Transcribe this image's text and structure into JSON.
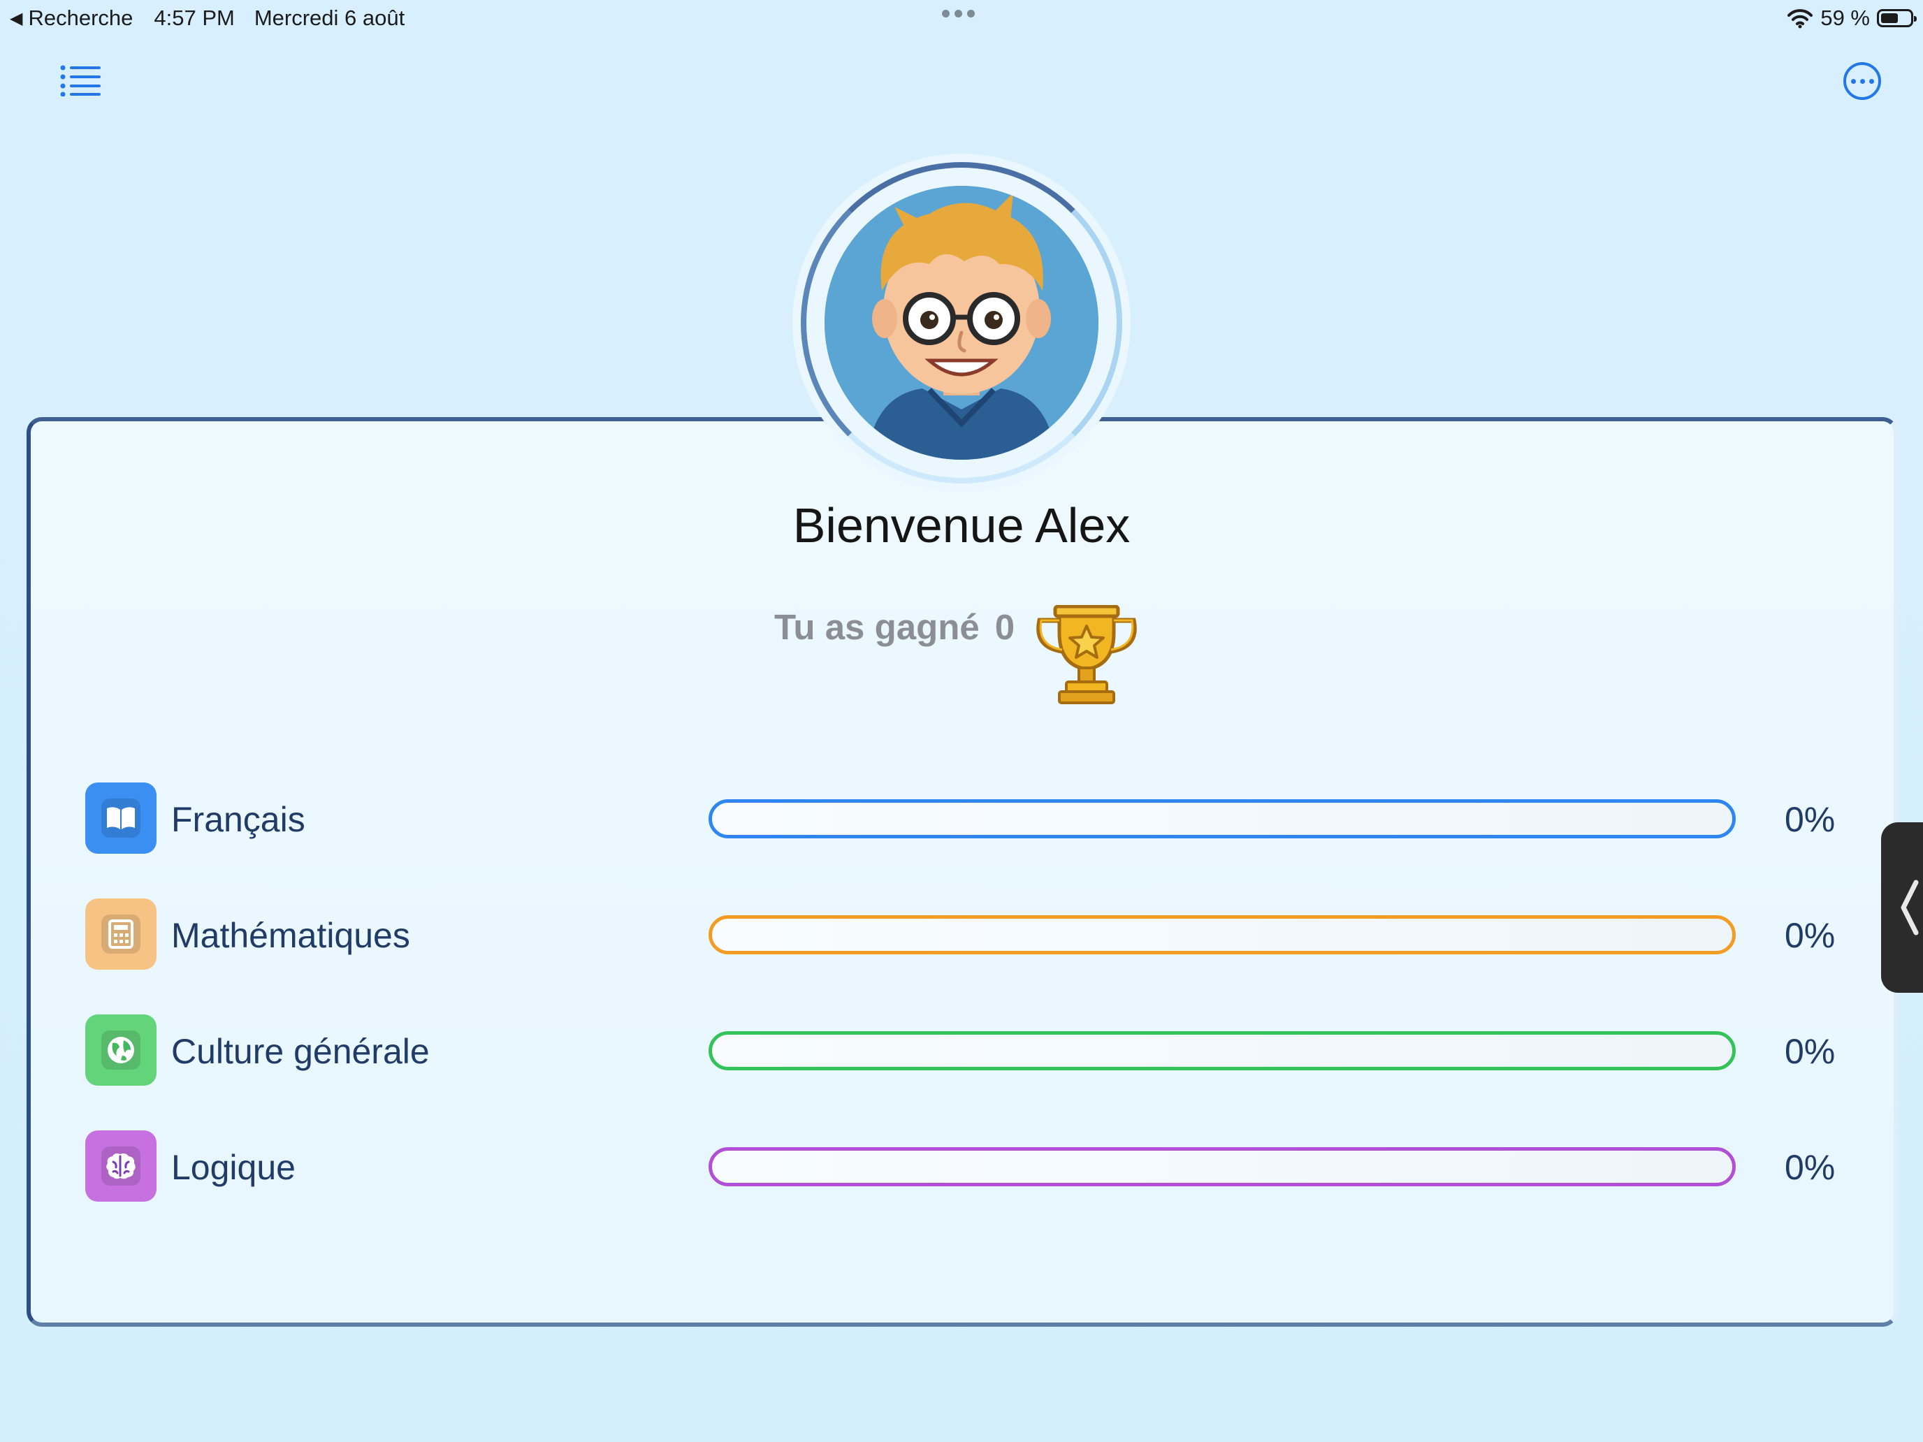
{
  "status_bar": {
    "back_label": "Recherche",
    "time": "4:57 PM",
    "date": "Mercredi 6 août",
    "battery_pct_label": "59 %",
    "battery_level": 0.59
  },
  "nav": {
    "menu_icon": "list-icon",
    "more_icon": "ellipsis-circle-icon"
  },
  "profile": {
    "welcome": "Bienvenue Alex",
    "earned_label": "Tu as gagné",
    "earned_value": "0",
    "trophy_icon": "trophy-icon"
  },
  "subjects": [
    {
      "name": "Français",
      "percent_label": "0%",
      "progress": 0,
      "color": "#2f86f0",
      "icon": "book-icon",
      "icon_bg": "#3b8ff2"
    },
    {
      "name": "Mathématiques",
      "percent_label": "0%",
      "progress": 0,
      "color": "#f39c24",
      "icon": "calculator-icon",
      "icon_bg": "#f6c385"
    },
    {
      "name": "Culture générale",
      "percent_label": "0%",
      "progress": 0,
      "color": "#34c25a",
      "icon": "globe-icon",
      "icon_bg": "#63d47a"
    },
    {
      "name": "Logique",
      "percent_label": "0%",
      "progress": 0,
      "color": "#b14fd6",
      "icon": "brain-icon",
      "icon_bg": "#c770e0"
    }
  ],
  "colors": {
    "accent": "#2377e8",
    "text_dark": "#1f3b66",
    "muted": "#8b8f95"
  }
}
